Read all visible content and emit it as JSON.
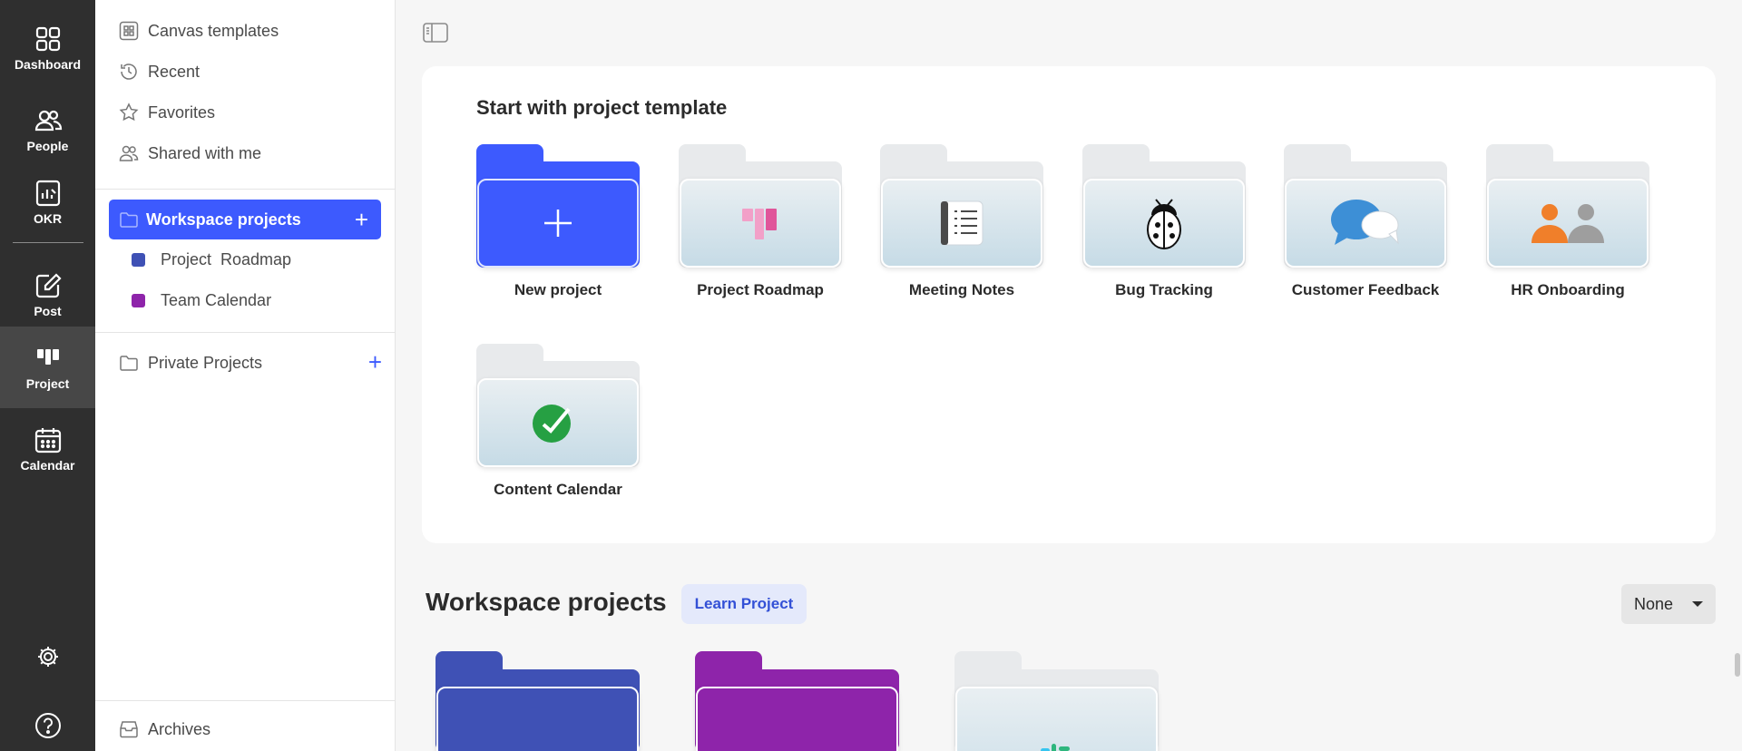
{
  "rail": {
    "dashboard": "Dashboard",
    "people": "People",
    "okr": "OKR",
    "post": "Post",
    "project": "Project",
    "calendar": "Calendar"
  },
  "sidebar": {
    "canvas_templates": "Canvas templates",
    "recent": "Recent",
    "favorites": "Favorites",
    "shared": "Shared with me",
    "workspace_projects": "Workspace projects",
    "workspace_items": [
      {
        "label": "Project  Roadmap",
        "color": "#3f51b5"
      },
      {
        "label": "Team Calendar",
        "color": "#8e24aa"
      }
    ],
    "private_projects": "Private Projects",
    "archives": "Archives"
  },
  "templates": {
    "title": "Start with project template",
    "items": [
      {
        "label": "New project",
        "icon": "plus-icon"
      },
      {
        "label": "Project Roadmap",
        "icon": "roadmap-icon"
      },
      {
        "label": "Meeting Notes",
        "icon": "notebook-icon"
      },
      {
        "label": "Bug Tracking",
        "icon": "ladybug-icon"
      },
      {
        "label": "Customer Feedback",
        "icon": "chat-bubbles-icon"
      },
      {
        "label": "HR Onboarding",
        "icon": "people-icon"
      },
      {
        "label": "Content Calendar",
        "icon": "check-circle-icon"
      }
    ]
  },
  "workspace": {
    "title": "Workspace projects",
    "learn_label": "Learn Project",
    "sort_value": "None",
    "folder_colors": [
      "#3f51b5",
      "#8e24aa",
      "#e8eaec"
    ]
  },
  "colors": {
    "accent": "#3d5afe",
    "rail_bg": "#2f2f2f"
  }
}
